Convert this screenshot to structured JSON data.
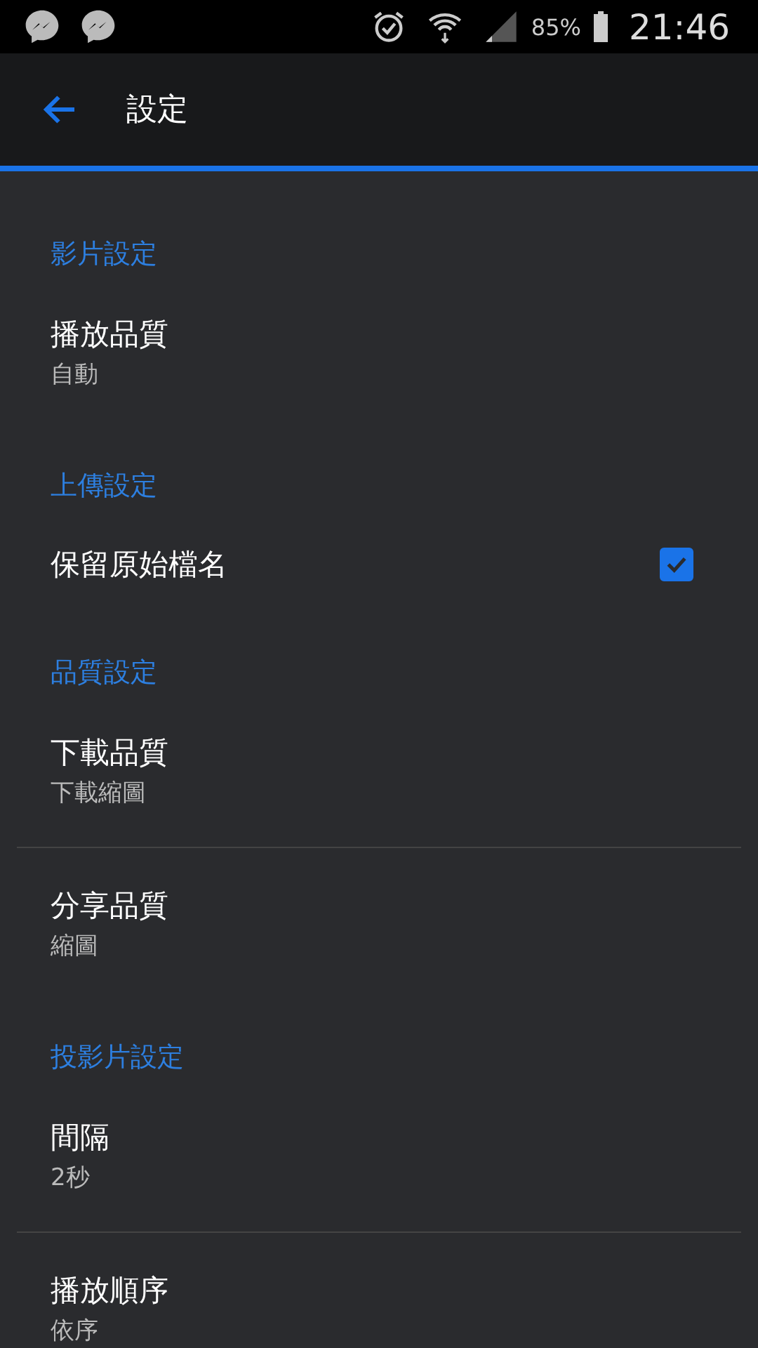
{
  "status_bar": {
    "battery": "85%",
    "time": "21:46"
  },
  "toolbar": {
    "title": "設定"
  },
  "sections": [
    {
      "header": "影片設定",
      "items": [
        {
          "kind": "value",
          "title": "播放品質",
          "value": "自動"
        }
      ]
    },
    {
      "header": "上傳設定",
      "items": [
        {
          "kind": "checkbox",
          "title": "保留原始檔名",
          "checked": true
        }
      ]
    },
    {
      "header": "品質設定",
      "items": [
        {
          "kind": "value",
          "title": "下載品質",
          "value": "下載縮圖"
        },
        {
          "kind": "value",
          "title": "分享品質",
          "value": "縮圖"
        }
      ]
    },
    {
      "header": "投影片設定",
      "items": [
        {
          "kind": "value",
          "title": "間隔",
          "value": "2秒"
        },
        {
          "kind": "value",
          "title": "播放順序",
          "value": "依序"
        }
      ]
    }
  ]
}
